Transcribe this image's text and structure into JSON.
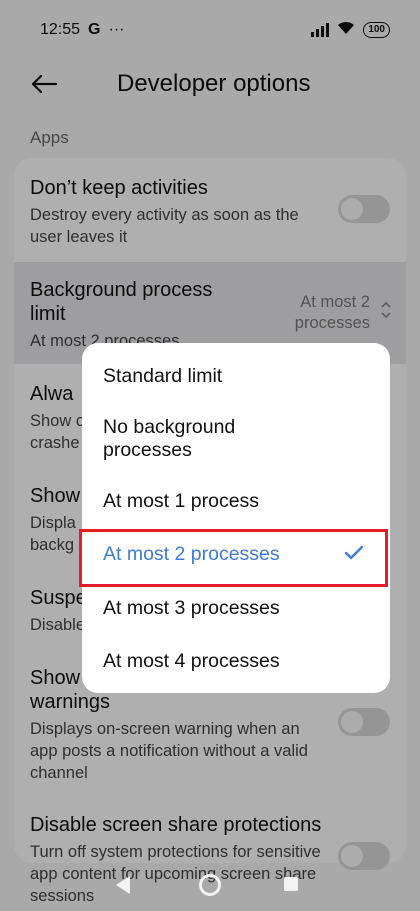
{
  "status": {
    "time": "12:55",
    "carrier_icon": "G",
    "more": "···",
    "battery": "100"
  },
  "header": {
    "title": "Developer options"
  },
  "section": {
    "label": "Apps"
  },
  "items": [
    {
      "title": "Don’t keep activities",
      "desc": "Destroy every activity as soon as the user leaves it"
    },
    {
      "title": "Background process limit",
      "desc": "At most 2 processes",
      "value": "At most 2 processes"
    },
    {
      "title": "Alwa",
      "desc": "Show c\ncrashe"
    },
    {
      "title": "Show",
      "desc": "Displa\nbackg"
    },
    {
      "title": "Suspe",
      "desc": "Disable"
    },
    {
      "title": "Show\nwarnings",
      "desc": "Displays on-screen warning when an app posts a notification without a valid channel"
    },
    {
      "title": "Disable screen share protections",
      "desc": "Turn off system protections for sensitive app content for upcoming screen share sessions"
    }
  ],
  "dialog": {
    "options": [
      "Standard limit",
      "No background processes",
      "At most 1 process",
      "At most 2 processes",
      "At most 3 processes",
      "At most 4 processes"
    ],
    "selected_index": 3
  },
  "colors": {
    "accent": "#3e7bd6",
    "highlight": "#e41c2a"
  }
}
